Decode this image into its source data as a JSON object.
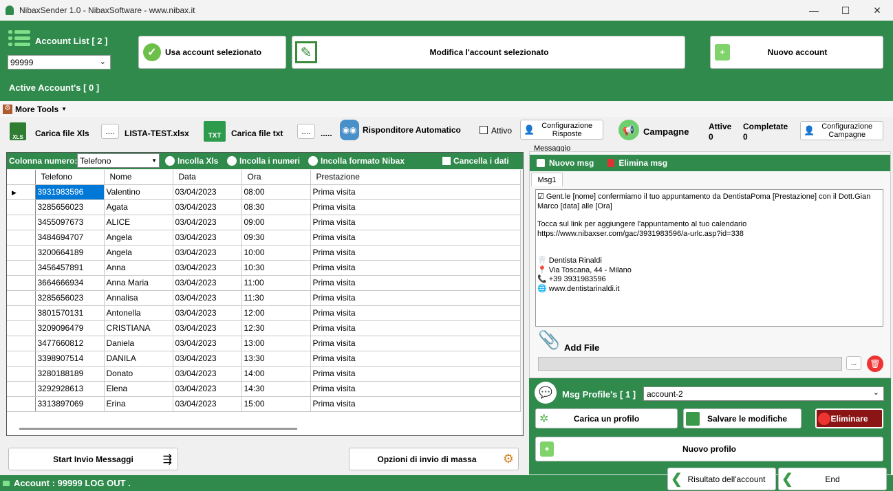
{
  "window": {
    "title": "NibaxSender 1.0 - NibaxSoftware - www.nibax.it",
    "minimize": "—",
    "maximize": "☐",
    "close": "✕"
  },
  "account": {
    "list_label": "Account List [ 2 ]",
    "selected": "99999",
    "active_label": "Active Account's [ 0 ]",
    "use_btn": "Usa account selezionato",
    "edit_btn": "Modifica l'account selezionato",
    "new_btn": "Nuovo account"
  },
  "menu": {
    "more_tools": "More Tools"
  },
  "tools": {
    "load_xls": "Carica file Xls",
    "browse1": "....",
    "xls_file": "LISTA-TEST.xlsx",
    "load_txt": "Carica file txt",
    "browse2": "....",
    "browse3": ".....",
    "auto_reply": "Risponditore Automatico",
    "active": "Attivo",
    "config_replies": "Configurazione Risposte",
    "campaigns": "Campagne",
    "attive_label": "Attive",
    "attive_val": "0",
    "completate_label": "Completate",
    "completate_val": "0",
    "config_campaigns": "Configurazione Campagne"
  },
  "gridbar": {
    "col_label": "Colonna numero:",
    "col_value": "Telefono",
    "paste_xls": "Incolla Xls",
    "paste_numbers": "Incolla i numeri",
    "paste_nibax": "Incolla formato Nibax",
    "clear": "Cancella i dati"
  },
  "grid": {
    "headers": [
      "Telefono",
      "Nome",
      "Data",
      "Ora",
      "Prestazione"
    ],
    "rows": [
      [
        "3931983596",
        "Valentino",
        "03/04/2023",
        "08:00",
        "Prima visita"
      ],
      [
        "3285656023",
        "Agata",
        "03/04/2023",
        "08:30",
        "Prima visita"
      ],
      [
        "3455097673",
        "ALICE",
        "03/04/2023",
        "09:00",
        "Prima visita"
      ],
      [
        "3484694707",
        "Angela",
        "03/04/2023",
        "09:30",
        "Prima visita"
      ],
      [
        "3200664189",
        "Angela",
        "03/04/2023",
        "10:00",
        "Prima visita"
      ],
      [
        "3456457891",
        "Anna",
        "03/04/2023",
        "10:30",
        "Prima visita"
      ],
      [
        "3664666934",
        "Anna Maria",
        "03/04/2023",
        "11:00",
        "Prima visita"
      ],
      [
        "3285656023",
        "Annalisa",
        "03/04/2023",
        "11:30",
        "Prima visita"
      ],
      [
        "3801570131",
        "Antonella",
        "03/04/2023",
        "12:00",
        "Prima visita"
      ],
      [
        "3209096479",
        "CRISTIANA",
        "03/04/2023",
        "12:30",
        "Prima visita"
      ],
      [
        "3477660812",
        "Daniela",
        "03/04/2023",
        "13:00",
        "Prima visita"
      ],
      [
        "3398907514",
        "DANILA",
        "03/04/2023",
        "13:30",
        "Prima visita"
      ],
      [
        "3280188189",
        "Donato",
        "03/04/2023",
        "14:00",
        "Prima visita"
      ],
      [
        "3292928613",
        "Elena",
        "03/04/2023",
        "14:30",
        "Prima visita"
      ],
      [
        "3313897069",
        "Erina",
        "03/04/2023",
        "15:00",
        "Prima visita"
      ]
    ]
  },
  "bottom": {
    "start": "Start Invio Messaggi",
    "options": "Opzioni di invio di massa"
  },
  "message": {
    "group_label": "Messaggio",
    "new_msg": "Nuovo msg",
    "delete_msg": "Elimina msg",
    "tab": "Msg1",
    "line1": "☑ Gent.le [nome] confermiamo il tuo appuntamento da DentistaPoma [Prestazione] con il Dott.Gian Marco [data] alle [Ora]",
    "line2": "Tocca sul link per aggiungere l'appuntamento al tuo calendario",
    "line3": "https://www.nibaxser.com/gac/3931983596/a-urlc.asp?id=338",
    "line4": "🦷 Dentista Rinaldi",
    "line5": "📍 Via Toscana, 44 - Milano",
    "line6": "📞 +39 3931983596",
    "line7": "🌐 www.dentistarinaldi.it",
    "add_file": "Add File",
    "browse": "..."
  },
  "profiles": {
    "label": "Msg Profile's [ 1 ]",
    "selected": "account-2",
    "load": "Carica un profilo",
    "save": "Salvare le modifiche",
    "delete": "Eliminare",
    "new": "Nuovo profilo"
  },
  "footer": {
    "result": "Risultato dell'account",
    "end": "End"
  },
  "status": {
    "text": "Account : 99999 LOG OUT ."
  }
}
